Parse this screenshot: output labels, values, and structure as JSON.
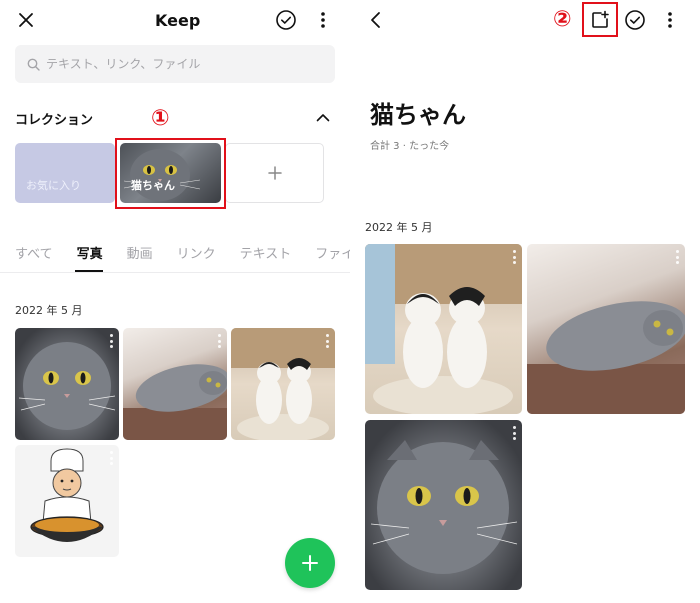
{
  "left": {
    "header": {
      "title": "Keep",
      "close_icon": "close-icon",
      "check_icon": "check-circle-icon",
      "more_icon": "more-vertical-icon"
    },
    "search": {
      "placeholder": "テキスト、リンク、ファイル",
      "icon": "search-icon"
    },
    "collection": {
      "label": "コレクション",
      "toggle_icon": "chevron-up-icon",
      "cards": [
        {
          "label": "お気に入り"
        },
        {
          "label": "猫ちゃん"
        }
      ],
      "add_icon": "plus-icon"
    },
    "marker_1": "①",
    "tabs": [
      {
        "label": "すべて",
        "active": false
      },
      {
        "label": "写真",
        "active": true
      },
      {
        "label": "動画",
        "active": false
      },
      {
        "label": "リンク",
        "active": false
      },
      {
        "label": "テキスト",
        "active": false
      },
      {
        "label": "ファイ",
        "active": false
      }
    ],
    "date": "2022 年 5 月",
    "fab_icon": "plus-icon",
    "accent": "#1fc35a"
  },
  "right": {
    "header": {
      "back_icon": "chevron-left-icon",
      "add_icon": "add-box-icon",
      "check_icon": "check-circle-icon",
      "more_icon": "more-vertical-icon"
    },
    "marker_2": "②",
    "title": "猫ちゃん",
    "meta": "合計 3 · たった今",
    "date": "2022 年 5 月"
  },
  "highlight_color": "#e1101a"
}
